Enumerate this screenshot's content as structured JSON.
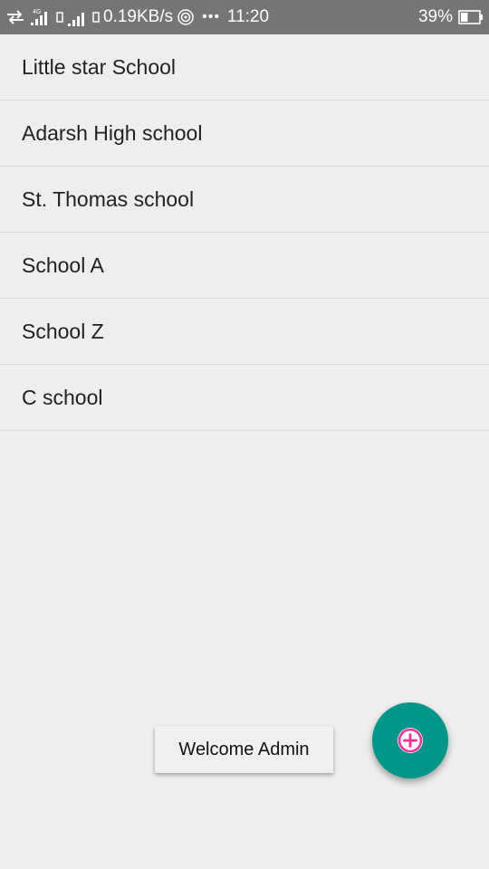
{
  "status_bar": {
    "network_type": "4G",
    "speed": "0.19KB/s",
    "more": "•••",
    "time": "11:20",
    "battery_percent": "39%",
    "battery_level": 0.39
  },
  "schools": [
    "Little star School",
    "Adarsh High school",
    "St.  Thomas school",
    "School A",
    "School Z",
    "C school"
  ],
  "toast": {
    "message": "Welcome Admin"
  },
  "fab": {
    "icon": "add-circle-icon",
    "icon_color": "#ff2d96",
    "background": "#00968a"
  }
}
